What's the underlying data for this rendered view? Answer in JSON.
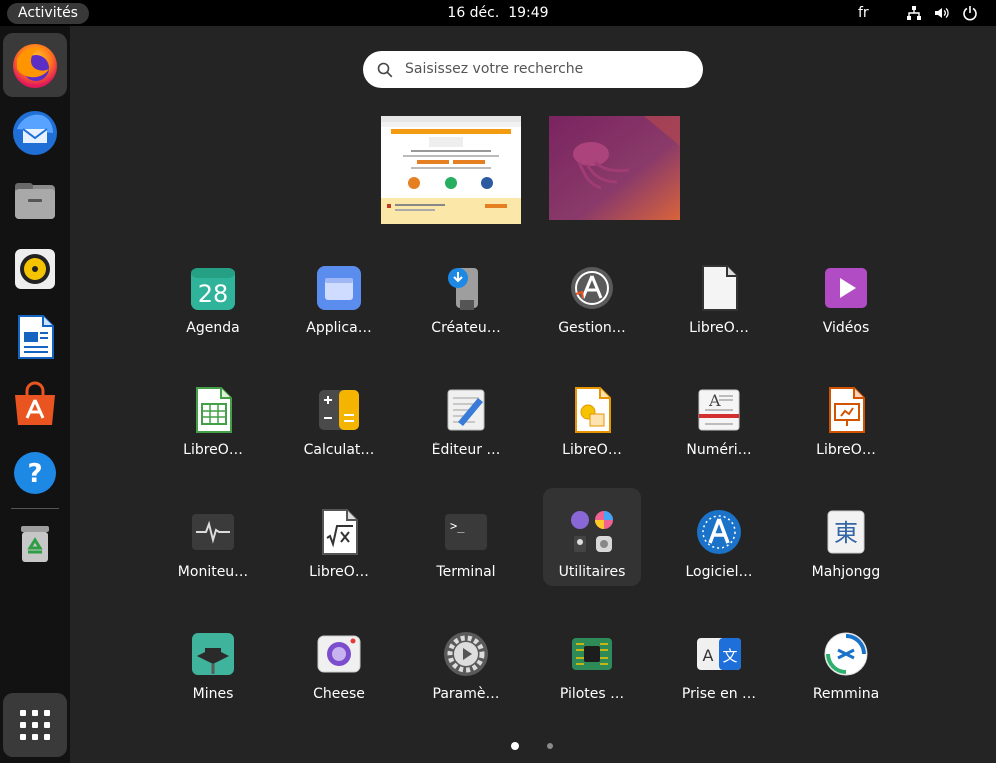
{
  "topbar": {
    "activities": "Activités",
    "date": "16 déc.",
    "time": "19:49",
    "lang": "fr",
    "icons": [
      "network-icon",
      "volume-icon",
      "power-icon"
    ]
  },
  "dock": {
    "items": [
      {
        "name": "firefox",
        "icon": "firefox-icon"
      },
      {
        "name": "thunderbird",
        "icon": "thunderbird-icon"
      },
      {
        "name": "files",
        "icon": "files-icon"
      },
      {
        "name": "rhythmbox",
        "icon": "rhythmbox-icon"
      },
      {
        "name": "libreoffice-writer",
        "icon": "writer-icon"
      },
      {
        "name": "software",
        "icon": "software-icon"
      },
      {
        "name": "help",
        "icon": "help-icon"
      },
      {
        "name": "trash",
        "icon": "trash-icon"
      }
    ],
    "show_apps": "grid-icon",
    "help_glyph": "?"
  },
  "search": {
    "placeholder": "Saisissez votre recherche"
  },
  "calendar_day": "28",
  "terminal_prompt": ">_",
  "mahjongg_glyph": "東",
  "translate_glyphs": [
    "A",
    "文"
  ],
  "apps": [
    {
      "label": "Agenda",
      "icon": "calendar-icon"
    },
    {
      "label": "Applica…",
      "icon": "applications-icon"
    },
    {
      "label": "Créateu…",
      "icon": "usb-creator-icon"
    },
    {
      "label": "Gestion…",
      "icon": "software-updater-icon"
    },
    {
      "label": "LibreO…",
      "icon": "libreoffice-icon"
    },
    {
      "label": "Vidéos",
      "icon": "videos-icon"
    },
    {
      "label": "LibreO…",
      "icon": "calc-icon"
    },
    {
      "label": "Calculat…",
      "icon": "calculator-icon"
    },
    {
      "label": "Éditeur …",
      "icon": "text-editor-icon"
    },
    {
      "label": "LibreO…",
      "icon": "draw-icon"
    },
    {
      "label": "Numéri…",
      "icon": "scanner-icon"
    },
    {
      "label": "LibreO…",
      "icon": "impress-icon"
    },
    {
      "label": "Moniteu…",
      "icon": "system-monitor-icon"
    },
    {
      "label": "LibreO…",
      "icon": "math-icon"
    },
    {
      "label": "Terminal",
      "icon": "terminal-icon"
    },
    {
      "label": "Utilitaires",
      "icon": "utilities-folder-icon"
    },
    {
      "label": "Logiciel…",
      "icon": "software-icon"
    },
    {
      "label": "Mahjongg",
      "icon": "mahjongg-icon"
    },
    {
      "label": "Mines",
      "icon": "mines-icon"
    },
    {
      "label": "Cheese",
      "icon": "cheese-icon"
    },
    {
      "label": "Paramè…",
      "icon": "settings-icon"
    },
    {
      "label": "Pilotes …",
      "icon": "drivers-icon"
    },
    {
      "label": "Prise en …",
      "icon": "language-support-icon"
    },
    {
      "label": "Remmina",
      "icon": "remmina-icon"
    }
  ],
  "pager": {
    "pages": 2,
    "current": 1
  },
  "colors": {
    "accent": "#e95420",
    "panel": "#000000",
    "background": "#242424"
  }
}
